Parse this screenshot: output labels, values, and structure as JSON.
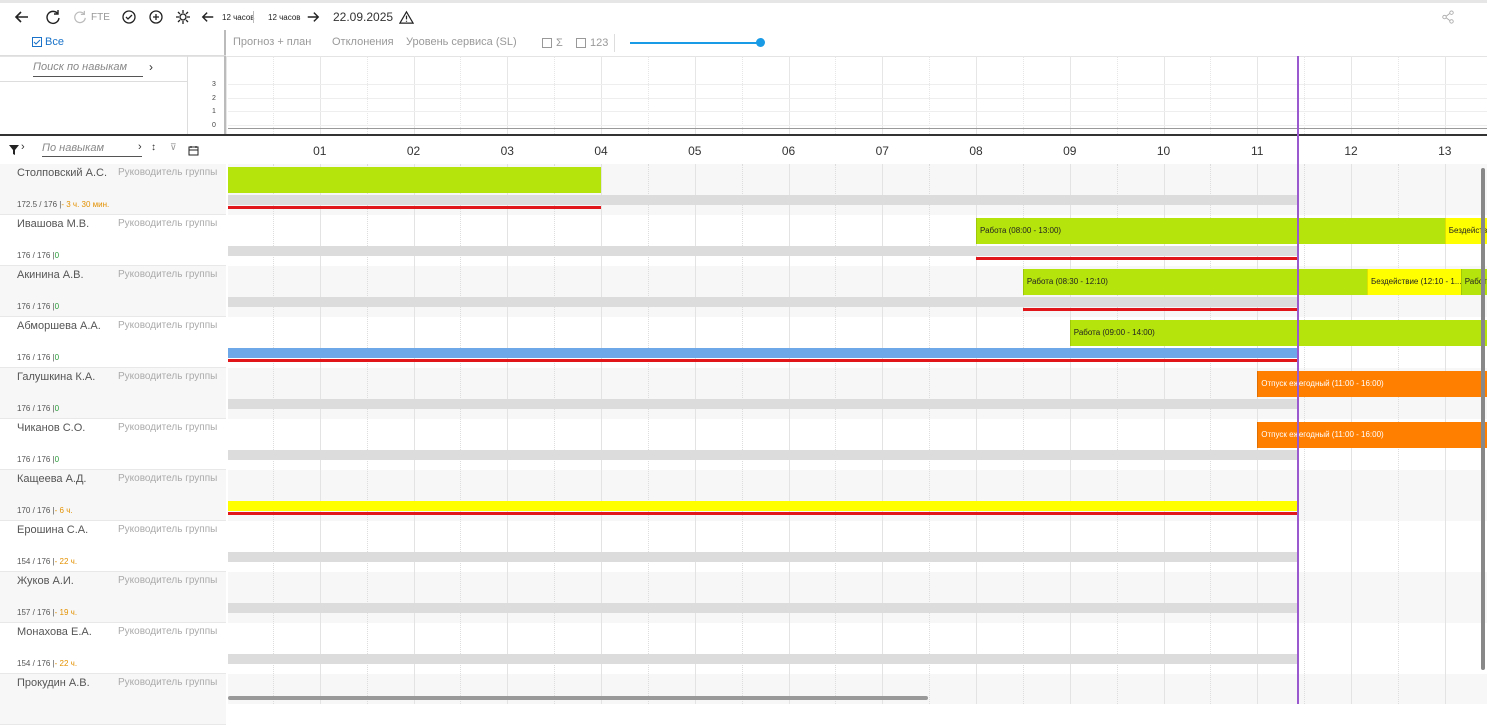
{
  "toolbar": {
    "fte_label": "FTE",
    "prev_step_label": "12 часов",
    "next_step_label": "12 часов",
    "date": "22.09.2025"
  },
  "filters": {
    "all_label": "Все",
    "tabs": [
      "Прогноз + план",
      "Отклонения",
      "Уровень сервиса (SL)"
    ],
    "sigma_label": "Σ",
    "count_label": "123",
    "slider_value": 1.0
  },
  "skills": {
    "search_placeholder": "Поиск по навыкам",
    "filter_placeholder": "По навыкам",
    "axis_ticks": [
      "3",
      "2",
      "1",
      "0"
    ]
  },
  "timeline": {
    "hours": [
      "01",
      "02",
      "03",
      "04",
      "05",
      "06",
      "07",
      "08",
      "09",
      "10",
      "11",
      "12",
      "13"
    ]
  },
  "employees": [
    {
      "name": "Столповский А.С.",
      "role": "Руководитель группы",
      "hours": "172.5 / 176",
      "delta": "3 ч. 30 мин.",
      "delta_class": "orange"
    },
    {
      "name": "Ивашова М.В.",
      "role": "Руководитель группы",
      "hours": "176 / 176",
      "delta": "0",
      "delta_class": "green"
    },
    {
      "name": "Акинина А.В.",
      "role": "Руководитель группы",
      "hours": "176 / 176",
      "delta": "0",
      "delta_class": "green"
    },
    {
      "name": "Абморшева А.А.",
      "role": "Руководитель группы",
      "hours": "176 / 176",
      "delta": "0",
      "delta_class": "green"
    },
    {
      "name": "Галушкина К.А.",
      "role": "Руководитель группы",
      "hours": "176 / 176",
      "delta": "0",
      "delta_class": "green"
    },
    {
      "name": "Чиканов С.О.",
      "role": "Руководитель группы",
      "hours": "176 / 176",
      "delta": "0",
      "delta_class": "green"
    },
    {
      "name": "Кащеева А.Д.",
      "role": "Руководитель группы",
      "hours": "170 / 176",
      "delta": "6 ч.",
      "delta_class": "orange"
    },
    {
      "name": "Ерошина С.А.",
      "role": "Руководитель группы",
      "hours": "154 / 176",
      "delta": "22 ч.",
      "delta_class": "orange"
    },
    {
      "name": "Жуков А.И.",
      "role": "Руководитель группы",
      "hours": "157 / 176",
      "delta": "19 ч.",
      "delta_class": "orange"
    },
    {
      "name": "Монахова Е.А.",
      "role": "Руководитель группы",
      "hours": "154 / 176",
      "delta": "22 ч.",
      "delta_class": "orange"
    },
    {
      "name": "Прокудин А.В.",
      "role": "Руководитель группы",
      "hours": "",
      "delta": "",
      "delta_class": ""
    }
  ],
  "shifts": [
    {
      "row": 0,
      "start": 0.0,
      "end": 4.0,
      "color": "#b5e40c",
      "label": ""
    },
    {
      "row": 1,
      "start": 8.0,
      "end": 13.0,
      "color": "#b5e40c",
      "label": "Работа (08:00 - 13:00)"
    },
    {
      "row": 1,
      "start": 13.0,
      "end": 13.45,
      "color": "#ffff00",
      "label": "Бездейств"
    },
    {
      "row": 2,
      "start": 8.5,
      "end": 12.17,
      "color": "#b5e40c",
      "label": "Работа (08:30 - 12:10)"
    },
    {
      "row": 2,
      "start": 12.17,
      "end": 13.17,
      "color": "#ffff00",
      "label": "Бездействие (12:10 - 1..."
    },
    {
      "row": 2,
      "start": 13.17,
      "end": 13.45,
      "color": "#b5e40c",
      "label": "Работ"
    },
    {
      "row": 3,
      "start": 9.0,
      "end": 13.45,
      "color": "#b5e40c",
      "label": "Работа (09:00 - 14:00)"
    },
    {
      "row": 4,
      "start": 11.0,
      "end": 13.45,
      "color": "#ff7f00",
      "label": "Отпуск ежегодный (11:00 - 16:00)"
    },
    {
      "row": 5,
      "start": 11.0,
      "end": 13.45,
      "color": "#ff7f00",
      "label": "Отпуск ежегодный (11:00 - 16:00)"
    }
  ],
  "bands": [
    {
      "row": 0,
      "start": 0,
      "end": 11.45,
      "color": "#dcdcdc"
    },
    {
      "row": 1,
      "start": 0,
      "end": 11.45,
      "color": "#dcdcdc"
    },
    {
      "row": 2,
      "start": 0,
      "end": 11.45,
      "color": "#dcdcdc"
    },
    {
      "row": 3,
      "start": 0,
      "end": 11.45,
      "color": "#6fa8e8"
    },
    {
      "row": 4,
      "start": 0,
      "end": 11.45,
      "color": "#dcdcdc"
    },
    {
      "row": 5,
      "start": 0,
      "end": 11.45,
      "color": "#dcdcdc"
    },
    {
      "row": 6,
      "start": 0,
      "end": 11.45,
      "color": "#ffff00"
    },
    {
      "row": 7,
      "start": 0,
      "end": 11.45,
      "color": "#dcdcdc"
    },
    {
      "row": 8,
      "start": 0,
      "end": 11.45,
      "color": "#dcdcdc"
    },
    {
      "row": 9,
      "start": 0,
      "end": 11.45,
      "color": "#dcdcdc"
    }
  ],
  "deviations": [
    {
      "row": 0,
      "start": 0,
      "end": 4.0
    },
    {
      "row": 1,
      "start": 8.0,
      "end": 11.45
    },
    {
      "row": 2,
      "start": 8.5,
      "end": 11.45
    },
    {
      "row": 3,
      "start": 0,
      "end": 11.45
    },
    {
      "row": 6,
      "start": 0,
      "end": 11.45
    }
  ],
  "now_hour": 11.45,
  "colors": {
    "accent": "#1a9be6",
    "now_line": "#9b59d0",
    "deviation": "#e0161b"
  }
}
